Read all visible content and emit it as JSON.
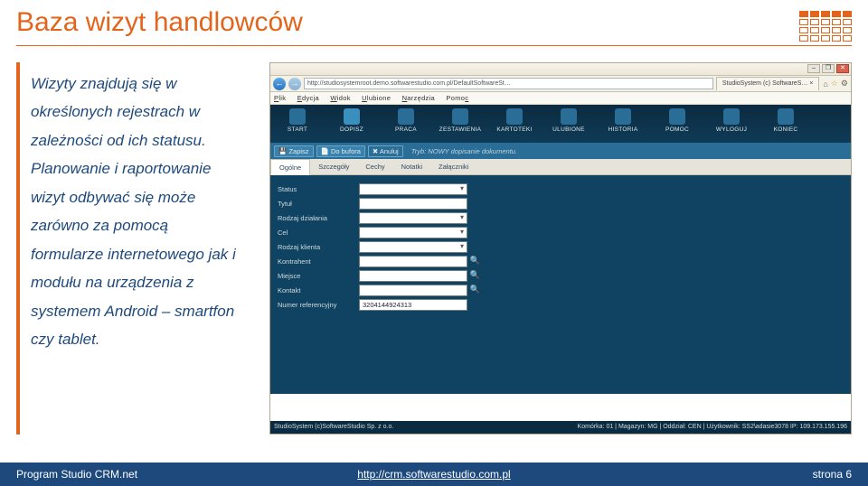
{
  "title": "Baza wizyt handlowców",
  "description_p1": "Wizyty znajdują się w określonych rejestrach w zależności od ich statusu.",
  "description_p2": "Planowanie i raportowanie wizyt odbywać się może zarówno za pomocą formularze internetowego jak i modułu na urządzenia z systemem Android – smartfon czy tablet.",
  "browser": {
    "url": "http://studiosystemroot.demo.softwarestudio.com.pl/DefaultSoftwareSt…",
    "tab_label": "StudioSystem (c) SoftwareS… ×",
    "menu": [
      "Plik",
      "Edycja",
      "Widok",
      "Ulubione",
      "Narzędzia",
      "Pomoc"
    ]
  },
  "toolbar": {
    "items": [
      "START",
      "DOPISZ",
      "PRACA",
      "ZESTAWIENIA",
      "KARTOTEKI",
      "ULUBIONE",
      "HISTORIA",
      "POMOC",
      "WYLOGUJ",
      "KONIEC"
    ]
  },
  "actions": {
    "zapisz": "Zapisz",
    "dobufora": "Do bufora",
    "anuluj": "Anuluj",
    "tryb": "Tryb: NOWY dopisanie dokumentu."
  },
  "innertabs": [
    "Ogólne",
    "Szczegóły",
    "Cechy",
    "Notatki",
    "Załączniki"
  ],
  "form": {
    "rows": [
      {
        "label": "Status",
        "type": "caret"
      },
      {
        "label": "Tytuł",
        "type": "plain"
      },
      {
        "label": "Rodzaj działania",
        "type": "caret"
      },
      {
        "label": "Cel",
        "type": "caret"
      },
      {
        "label": "Rodzaj klienta",
        "type": "caret"
      },
      {
        "label": "Kontrahent",
        "type": "search"
      },
      {
        "label": "Miejsce",
        "type": "search"
      },
      {
        "label": "Kontakt",
        "type": "search"
      },
      {
        "label": "Numer referencyjny",
        "type": "value",
        "value": "3204144924313"
      }
    ]
  },
  "status": {
    "left": "StudioSystem (c)SoftwareStudio Sp. z o.o.",
    "right": "Komórka: 01 | Magazyn: MG | Oddział: CEN | Użytkownik: SS2\\adasie3078 IP: 109.173.155.196"
  },
  "footer": {
    "program": "Program Studio CRM.net",
    "url": "http://crm.softwarestudio.com.pl",
    "page": "strona 6"
  }
}
